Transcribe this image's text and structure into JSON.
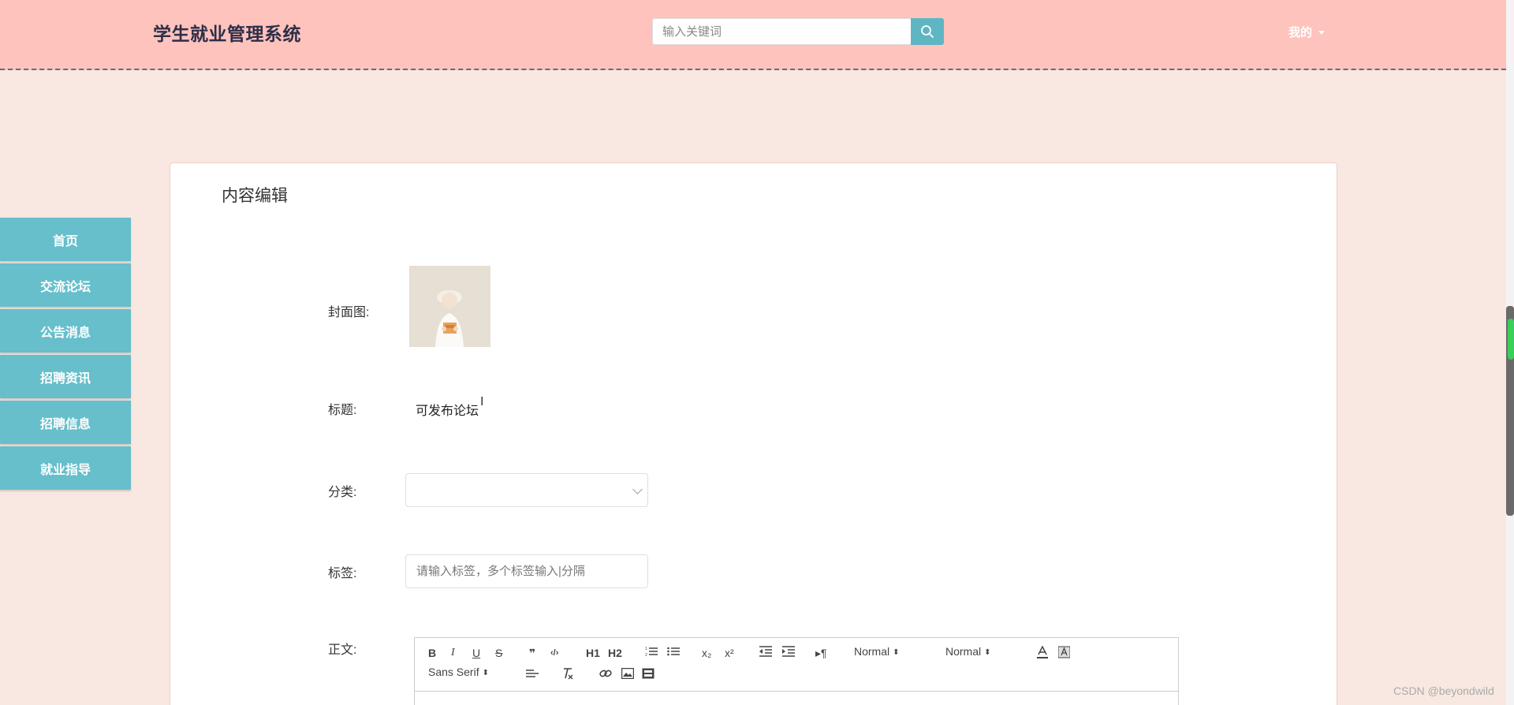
{
  "header": {
    "app_title": "学生就业管理系统",
    "search_placeholder": "输入关键词",
    "search_icon": "search-icon",
    "user_menu_label": "我的"
  },
  "sidebar": {
    "items": [
      {
        "label": "首页"
      },
      {
        "label": "交流论坛"
      },
      {
        "label": "公告消息"
      },
      {
        "label": "招聘资讯"
      },
      {
        "label": "招聘信息"
      },
      {
        "label": "就业指导"
      }
    ]
  },
  "form": {
    "card_title": "内容编辑",
    "cover_label": "封面图:",
    "title_label": "标题:",
    "title_value": "可发布论坛",
    "category_label": "分类:",
    "category_value": "",
    "tags_label": "标签:",
    "tags_placeholder": "请输入标签，多个标签输入|分隔",
    "body_label": "正文:"
  },
  "editor": {
    "toolbar": {
      "bold": "B",
      "italic": "I",
      "underline": "U",
      "strike": "S",
      "blockquote": "❞",
      "code": "‹/›",
      "h1": "H1",
      "h2": "H2",
      "subscript": "x₂",
      "superscript": "x²",
      "direction": "▸¶",
      "size_value": "Normal",
      "header_value": "Normal",
      "font_value": "Sans Serif"
    }
  },
  "watermark": "CSDN @beyondwild",
  "colors": {
    "header_bg": "#fdc3bc",
    "page_bg": "#f8e8e1",
    "accent": "#66bfcb"
  }
}
